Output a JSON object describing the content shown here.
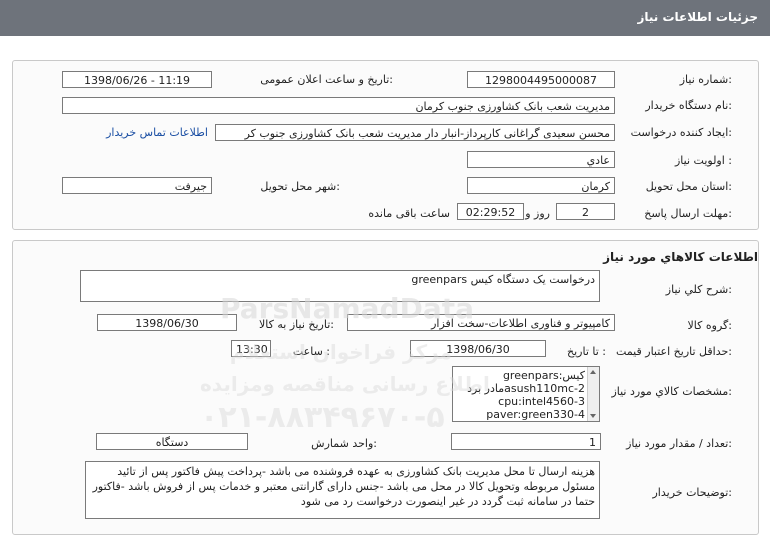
{
  "header": {
    "title": "جزئیات اطلاعات نیاز"
  },
  "need_info": {
    "need_number_label": "شماره نیاز:",
    "need_number": "1298004495000087",
    "announce_label": "تاریخ و ساعت اعلان عمومی:",
    "announce_value": "1398/06/26 - 11:19",
    "buyer_label": "نام دستگاه خریدار:",
    "buyer_value": "مدیریت شعب بانک کشاورزی جنوب کرمان",
    "creator_label": "ایجاد کننده درخواست:",
    "creator_value": "محسن سعیدی گراغانی کارپرداز-انبار دار مدیریت شعب بانک کشاورزی جنوب کر",
    "contact_link": "اطلاعات تماس خریدار",
    "priority_label": "اولویت نیاز :",
    "priority_value": "عادي",
    "province_label": "استان محل تحویل:",
    "province_value": "کرمان",
    "city_label": "شهر محل تحویل:",
    "city_value": "جیرفت",
    "deadline_label": "مهلت ارسال پاسخ:",
    "days_value": "2",
    "days_text": "روز و",
    "time_value": "02:29:52",
    "remaining_text": "ساعت باقی مانده"
  },
  "goods": {
    "section_title": "اطلاعات کالاهاي مورد نياز",
    "desc_label": "شرح کلي نياز:",
    "desc_value": "درخواست یک دستگاه کیس greenpars",
    "group_label": "گروه کالا:",
    "group_value": "کامپیوتر و فناوری اطلاعات-سخت افزار",
    "need_date_label": "تاریخ نیاز به کالا:",
    "need_date_value": "1398/06/30",
    "validity_label": "حداقل تاریخ اعتبار قیمت:",
    "until_date_label": "تا تاریخ :",
    "validity_date": "1398/06/30",
    "hour_label": "ساعت :",
    "validity_time": "13:30",
    "specs_label": "مشخصات کالاي مورد نياز:",
    "specs_lines": [
      "کیس:greenpars",
      "asush110mc-2مادر برد",
      "cpu:intel4560-3",
      "paver:green330-4"
    ],
    "qty_label": "تعداد / مقدار مورد نیاز:",
    "qty_value": "1",
    "unit_label": "واحد شمارش:",
    "unit_value": "دستگاه",
    "buyer_notes_label": "توضیحات خریدار:",
    "buyer_notes": "هزینه ارسال تا محل مدیریت بانک کشاورزی به عهده فروشنده می باشد -پرداخت پیش فاکتور پس از تائید مسئول مربوطه وتحویل کالا در محل می باشد -جنس دارای گارانتی معتبر و خدمات پس از فروش باشد -فاکتور حتما در سامانه ثبت گردد در غیر اینصورت درخواست رد می شود"
  },
  "watermark": {
    "site": "ParsNamadData",
    "line1": "مرکز فراخوان استعلام",
    "line2": "اطلاع رسانی مناقصه ومزایده",
    "phone": "۰۲۱-۸۸۳۴۹۶۷۰-۵"
  }
}
